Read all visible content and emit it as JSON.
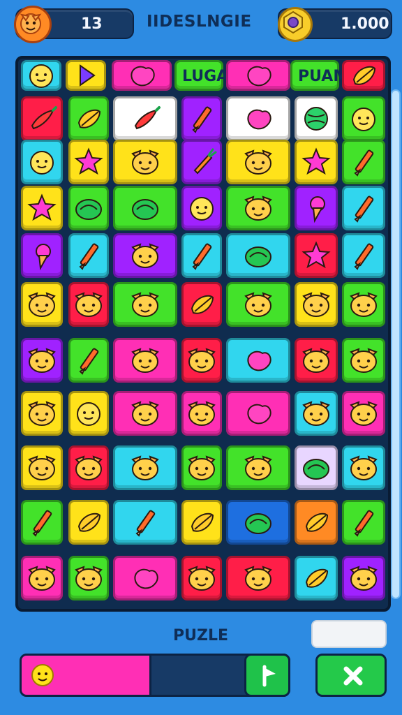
{
  "hud": {
    "left_value": "13",
    "title": "IIDESLNGIE",
    "right_value": "1.000"
  },
  "header_row": {
    "label_1": "LUGAN",
    "label_2": "PUAME"
  },
  "board": {
    "tiles": [
      {
        "color": "#31d6ee",
        "icon": "chick"
      },
      {
        "color": "#ffe21a",
        "icon": "play"
      },
      {
        "color": "#ff2fb5",
        "icon": "blob"
      },
      {
        "color": "#ff2fb5",
        "icon": "blob"
      },
      {
        "color": "#ff2fb5",
        "icon": "blob"
      },
      {
        "color": "#ff2fb5",
        "icon": "blob"
      },
      {
        "color": "#ff2fb5",
        "icon": "blob"
      },
      {
        "color": "#ff1e48",
        "icon": "leaf"
      },
      {
        "color": "#ff1e48",
        "icon": "pepper"
      },
      {
        "color": "#43e22a",
        "icon": "leaf"
      },
      {
        "color": "#ffffff",
        "icon": "pepper"
      },
      {
        "color": "#a022ff",
        "icon": "pencil"
      },
      {
        "color": "#ffffff",
        "icon": "blob"
      },
      {
        "color": "#ffffff",
        "icon": "ball"
      },
      {
        "color": "#43e22a",
        "icon": "face"
      },
      {
        "color": "#31d6ee",
        "icon": "face"
      },
      {
        "color": "#ffe21a",
        "icon": "star"
      },
      {
        "color": "#ffe21a",
        "icon": "cat"
      },
      {
        "color": "#a022ff",
        "icon": "carrot"
      },
      {
        "color": "#ffe21a",
        "icon": "cat"
      },
      {
        "color": "#ffe21a",
        "icon": "star"
      },
      {
        "color": "#43e22a",
        "icon": "pencil"
      },
      {
        "color": "#ffe21a",
        "icon": "star"
      },
      {
        "color": "#43e22a",
        "icon": "cabbage"
      },
      {
        "color": "#43e22a",
        "icon": "cabbage"
      },
      {
        "color": "#a022ff",
        "icon": "face"
      },
      {
        "color": "#43e22a",
        "icon": "cat"
      },
      {
        "color": "#a022ff",
        "icon": "icecream"
      },
      {
        "color": "#31d6ee",
        "icon": "pencil"
      },
      {
        "color": "#a022ff",
        "icon": "icecream"
      },
      {
        "color": "#31d6ee",
        "icon": "pencil"
      },
      {
        "color": "#a022ff",
        "icon": "cat"
      },
      {
        "color": "#31d6ee",
        "icon": "pencil"
      },
      {
        "color": "#31d6ee",
        "icon": "cabbage"
      },
      {
        "color": "#ff1e48",
        "icon": "star"
      },
      {
        "color": "#31d6ee",
        "icon": "pencil"
      },
      {
        "color": "#ffe21a",
        "icon": "elephant"
      },
      {
        "color": "#ff1e48",
        "icon": "cat"
      },
      {
        "color": "#43e22a",
        "icon": "cat"
      },
      {
        "color": "#ff1e48",
        "icon": "leaf"
      },
      {
        "color": "#43e22a",
        "icon": "cat"
      },
      {
        "color": "#ffe21a",
        "icon": "pig"
      },
      {
        "color": "#43e22a",
        "icon": "cat"
      },
      {
        "color": "#a022ff",
        "icon": "bear"
      },
      {
        "color": "#43e22a",
        "icon": "pencil"
      },
      {
        "color": "#ff2fb5",
        "icon": "cat"
      },
      {
        "color": "#ff1e48",
        "icon": "cat"
      },
      {
        "color": "#31d6ee",
        "icon": "blob"
      },
      {
        "color": "#ff1e48",
        "icon": "bear"
      },
      {
        "color": "#43e22a",
        "icon": "cat"
      },
      {
        "color": "#ffe21a",
        "icon": "bear"
      },
      {
        "color": "#ffe21a",
        "icon": "face"
      },
      {
        "color": "#ff2fb5",
        "icon": "cat"
      },
      {
        "color": "#ff2fb5",
        "icon": "bear"
      },
      {
        "color": "#ff2fb5",
        "icon": "blob"
      },
      {
        "color": "#31d6ee",
        "icon": "cat"
      },
      {
        "color": "#ff2fb5",
        "icon": "cat"
      },
      {
        "color": "#ffe21a",
        "icon": "cat"
      },
      {
        "color": "#ff1e48",
        "icon": "pig"
      },
      {
        "color": "#31d6ee",
        "icon": "cat"
      },
      {
        "color": "#43e22a",
        "icon": "pig"
      },
      {
        "color": "#43e22a",
        "icon": "bear"
      },
      {
        "color": "#e8d6ff",
        "icon": "cabbage"
      },
      {
        "color": "#31d6ee",
        "icon": "cat"
      },
      {
        "color": "#43e22a",
        "icon": "pencil"
      },
      {
        "color": "#ffe21a",
        "icon": "leaf"
      },
      {
        "color": "#31d6ee",
        "icon": "pencil"
      },
      {
        "color": "#ffe21a",
        "icon": "leaf"
      },
      {
        "color": "#1e6fe0",
        "icon": "cabbage"
      },
      {
        "color": "#ff8a24",
        "icon": "leaf"
      },
      {
        "color": "#43e22a",
        "icon": "pencil"
      },
      {
        "color": "#ff2fb5",
        "icon": "bear"
      },
      {
        "color": "#43e22a",
        "icon": "pig"
      },
      {
        "color": "#ff2fb5",
        "icon": "blob"
      },
      {
        "color": "#ff1e48",
        "icon": "bear"
      },
      {
        "color": "#ff1e48",
        "icon": "bear"
      },
      {
        "color": "#31d6ee",
        "icon": "leaf"
      },
      {
        "color": "#a022ff",
        "icon": "cat"
      }
    ]
  },
  "bottom": {
    "puzzle_label": "PUZLE",
    "progress": 0.48
  }
}
